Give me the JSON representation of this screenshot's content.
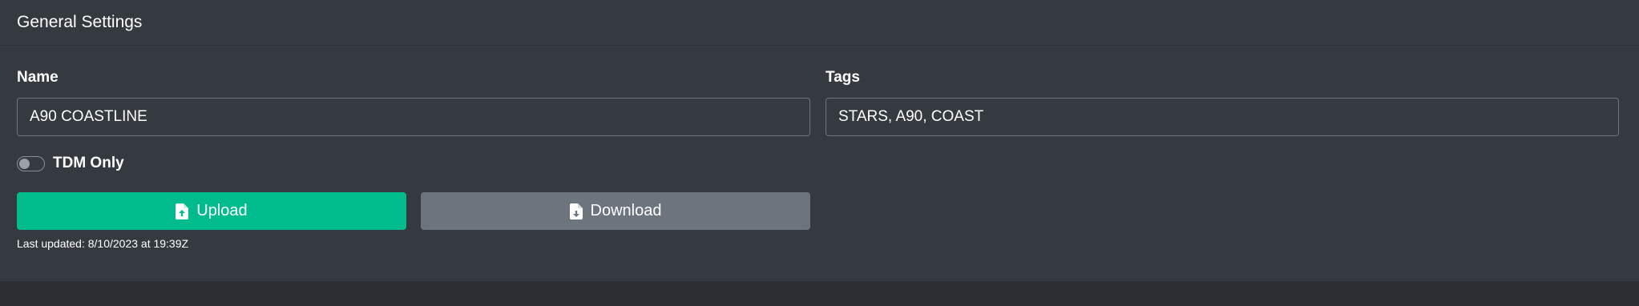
{
  "card": {
    "title": "General Settings"
  },
  "form": {
    "name_label": "Name",
    "name_value": "A90 COASTLINE",
    "tags_label": "Tags",
    "tags_value": "STARS, A90, COAST",
    "tdm_label": "TDM Only",
    "tdm_checked": false
  },
  "actions": {
    "upload_label": "Upload",
    "upload_icon": "file-upload-icon",
    "download_label": "Download",
    "download_icon": "file-download-icon"
  },
  "status": {
    "last_updated": "Last updated: 8/10/2023 at 19:39Z"
  },
  "colors": {
    "card_bg": "#343a40",
    "page_bg": "#2b2f34",
    "success": "#00bc8c",
    "secondary": "#6c757d"
  }
}
